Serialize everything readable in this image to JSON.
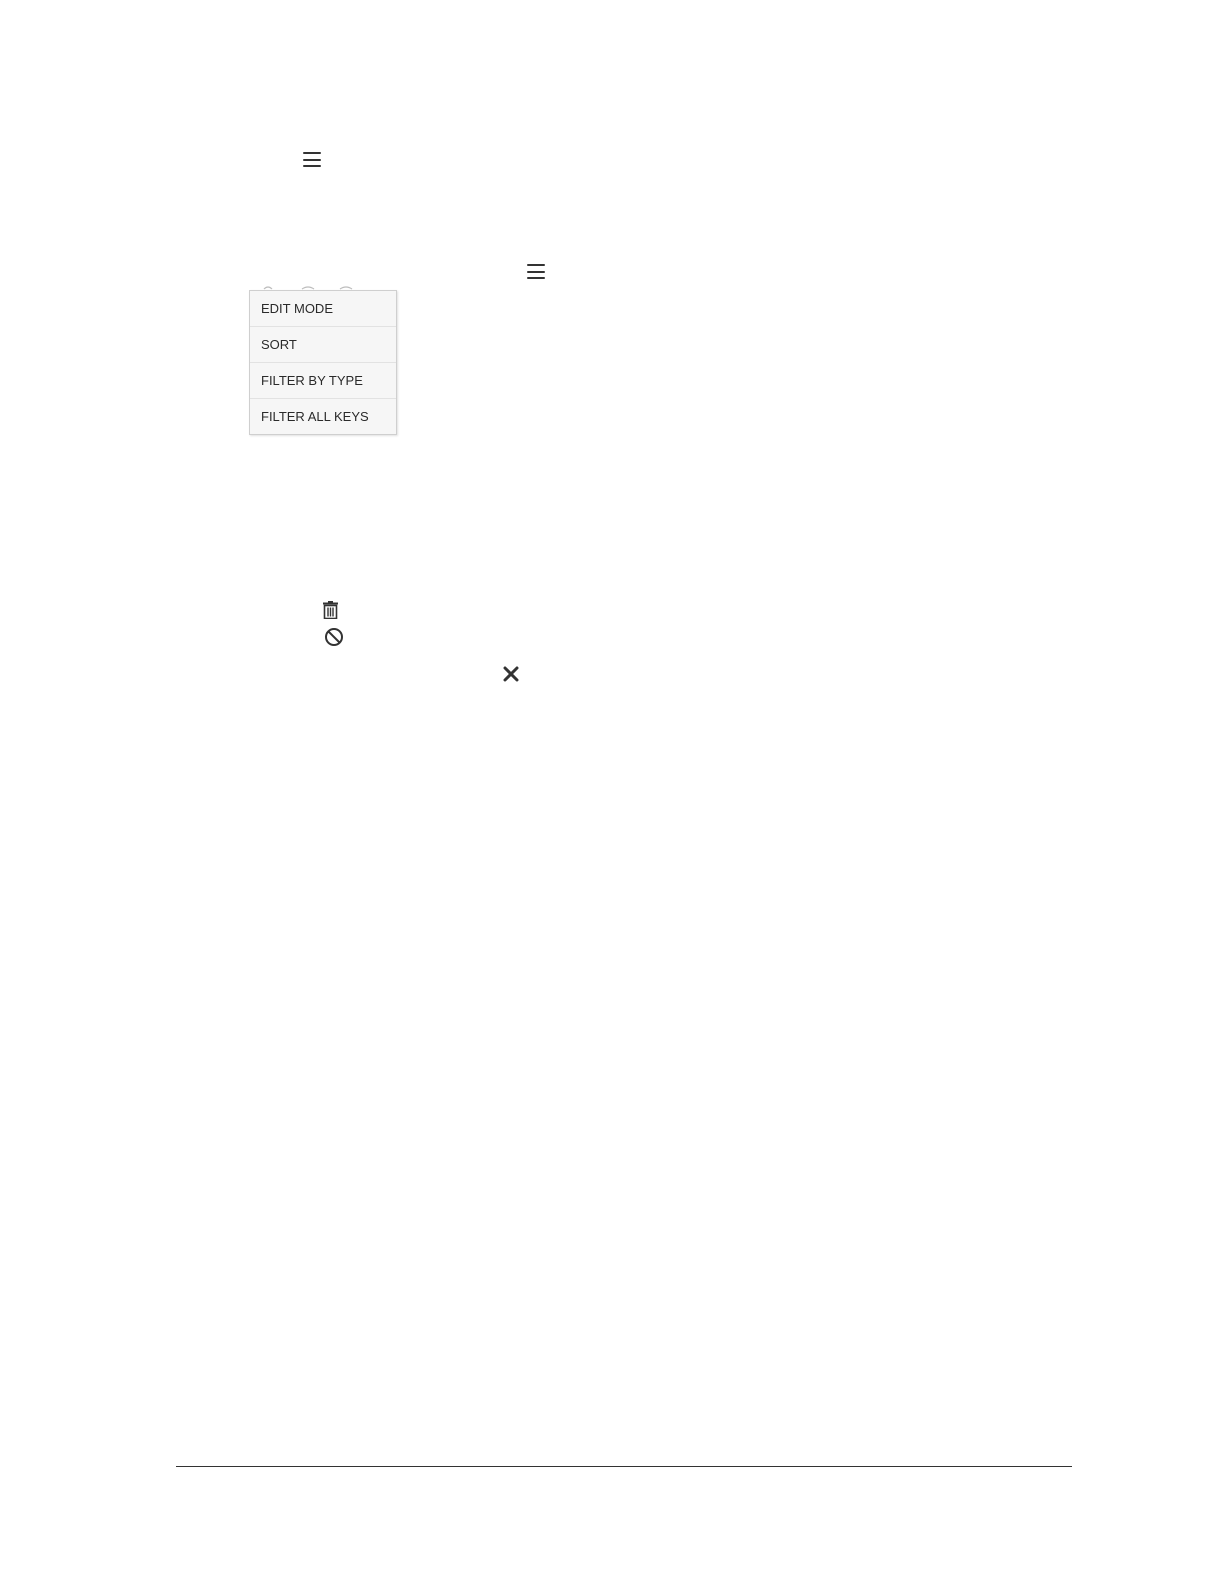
{
  "icons": {
    "menu_top": "hamburger-menu-icon",
    "menu_second": "hamburger-menu-icon",
    "delete": "trash-icon",
    "block": "prohibited-icon",
    "close": "close-icon"
  },
  "menu": {
    "items": [
      {
        "label": "EDIT MODE"
      },
      {
        "label": "SORT"
      },
      {
        "label": "FILTER BY TYPE"
      },
      {
        "label": "FILTER ALL KEYS"
      }
    ]
  },
  "colors": {
    "icon": "#333333",
    "menu_bg": "#f6f6f6",
    "menu_border": "#cfcfcf",
    "menu_text": "#2a2a2a",
    "rule": "#333333"
  }
}
